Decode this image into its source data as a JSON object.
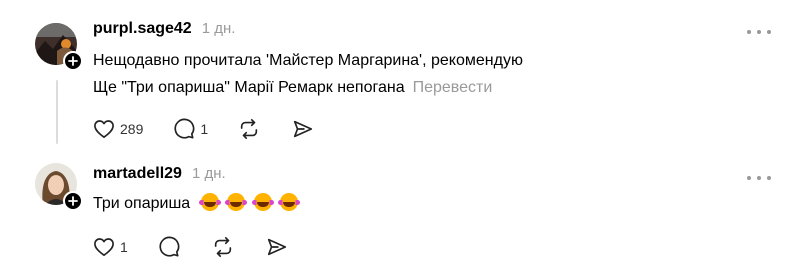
{
  "posts": [
    {
      "username": "purpl.sage42",
      "time": "1 дн.",
      "lines": [
        "Нещодавно прочитала 'Майстер Маргарина', рекомендую",
        "Ще \"Три опариша\" Марії Ремарк непогана"
      ],
      "translate_label": "Перевести",
      "likes": "289",
      "replies": "1"
    },
    {
      "username": "martadell29",
      "time": "1 дн.",
      "text": "Три опариша",
      "emoji_name": "rolling-on-floor-laughing",
      "emoji_count": 4,
      "likes": "1"
    }
  ],
  "icons": [
    "heart-icon",
    "comment-icon",
    "repost-icon",
    "share-icon",
    "more-icon",
    "follow-plus-icon"
  ]
}
